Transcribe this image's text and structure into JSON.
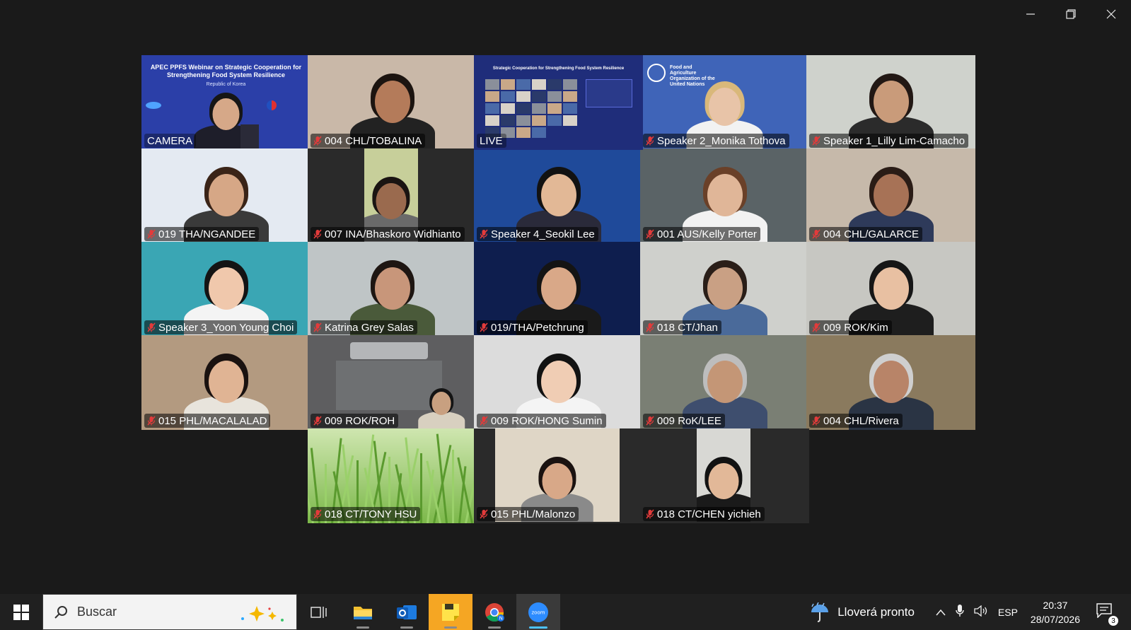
{
  "window": {
    "controls": [
      "minimize",
      "restore",
      "close"
    ]
  },
  "tiles": [
    {
      "label": "CAMERA",
      "muted": false,
      "kind": "slide-camera",
      "slide_title": "APEC PPFS Webinar on Strategic Cooperation for Strengthening Food System Resilience",
      "slide_subtitle": "Republic of Korea",
      "bg": "#2b3fa8"
    },
    {
      "label": "004 CHL/TOBALINA",
      "muted": true,
      "kind": "person",
      "bg": "#c9b8a8",
      "skin": "#b47b5a",
      "hair": "#1c1410",
      "shirt": "#222222"
    },
    {
      "label": "LIVE",
      "muted": false,
      "kind": "slide-live",
      "bg": "#1f2d7a",
      "slide_title": "Strategic Cooperation for Strengthening Food System Resilience"
    },
    {
      "label": "Speaker 2_Monika Tothova",
      "muted": true,
      "kind": "person-fao",
      "bg": "#3f64b8",
      "skin": "#e8c4a8",
      "hair": "#d9b87a",
      "shirt": "#f2f2f2",
      "org_text": "Food and Agriculture Organization of the United Nations"
    },
    {
      "label": "Speaker 1_Lilly Lim-Camacho",
      "muted": true,
      "kind": "person",
      "bg": "#cfd2cc",
      "skin": "#c99b7a",
      "hair": "#221814",
      "shirt": "#2b2b2b"
    },
    {
      "label": "019 THA/NGANDEE",
      "muted": true,
      "kind": "person",
      "bg": "#e4eaf2",
      "skin": "#d6a786",
      "hair": "#3a2418",
      "shirt": "#3a3a3a"
    },
    {
      "label": "007 INA/Bhaskoro Widhianto",
      "muted": true,
      "kind": "person-narrow",
      "bg": "#2a2a2a",
      "inner": "#c7cf9a",
      "skin": "#9a6a4e",
      "hair": "#1a1412",
      "shirt": "#6a6a6a"
    },
    {
      "label": "Speaker 4_Seokil Lee",
      "muted": true,
      "kind": "person",
      "bg": "#1f4a9a",
      "skin": "#e2b896",
      "hair": "#121212",
      "shirt": "#2a2a3a"
    },
    {
      "label": "001 AUS/Kelly Porter",
      "muted": true,
      "kind": "person",
      "bg": "#5a6366",
      "skin": "#e0b698",
      "hair": "#6a4028",
      "shirt": "#f2f2f2"
    },
    {
      "label": "004 CHL/GALARCE",
      "muted": true,
      "kind": "person",
      "bg": "#c6b9aa",
      "skin": "#a77256",
      "hair": "#2a1c16",
      "shirt": "#2e3a5a"
    },
    {
      "label": "Speaker 3_Yoon Young Choi",
      "muted": true,
      "kind": "person",
      "bg": "#3aa6b4",
      "skin": "#f0c8ac",
      "hair": "#141414",
      "shirt": "#f4f4f4"
    },
    {
      "label": "Katrina Grey Salas",
      "muted": true,
      "kind": "person",
      "bg": "#bfc5c6",
      "skin": "#c8967a",
      "hair": "#1e1612",
      "shirt": "#4a5a3a"
    },
    {
      "label": "019/THA/Petchrung",
      "muted": true,
      "kind": "person",
      "bg": "#0e1e4e",
      "skin": "#d9a888",
      "hair": "#141414",
      "shirt": "#1a1a1a"
    },
    {
      "label": "018 CT/Jhan",
      "muted": true,
      "kind": "person",
      "bg": "#cfd0cc",
      "skin": "#c9a084",
      "hair": "#2a1e18",
      "shirt": "#4a6a9a"
    },
    {
      "label": "009 ROK/Kim",
      "muted": true,
      "kind": "person",
      "bg": "#c7c7c2",
      "skin": "#e8c0a2",
      "hair": "#161616",
      "shirt": "#1e1e1e"
    },
    {
      "label": "015 PHL/MACALALAD",
      "muted": true,
      "kind": "person",
      "bg": "#b39a80",
      "skin": "#e0b494",
      "hair": "#1a1210",
      "shirt": "#e8e4dc"
    },
    {
      "label": "009 ROK/ROH",
      "muted": true,
      "kind": "room",
      "bg": "#5e5e60",
      "skin": "#c8a080",
      "hair": "#141414",
      "shirt": "#d8d0c0"
    },
    {
      "label": "009 ROK/HONG Sumin",
      "muted": true,
      "kind": "person",
      "bg": "#dcdcdc",
      "skin": "#f0cdb4",
      "hair": "#121212",
      "shirt": "#f4f4f4"
    },
    {
      "label": "009 RoK/LEE",
      "muted": true,
      "kind": "person",
      "bg": "#7a7f74",
      "skin": "#c49676",
      "hair": "#bdbdbd",
      "shirt": "#3e4e6e"
    },
    {
      "label": "004 CHL/Rivera",
      "muted": true,
      "kind": "person",
      "bg": "#8a7a5e",
      "skin": "#b88468",
      "hair": "#cfcfcf",
      "shirt": "#2a3444"
    },
    {
      "label": "018 CT/TONY HSU",
      "muted": true,
      "kind": "grass",
      "bg": "#8ac05a"
    },
    {
      "label": "015 PHL/Malonzo",
      "muted": true,
      "kind": "person-narrow",
      "bg": "#2a2a2a",
      "inner": "#dfd6c6",
      "skin": "#d8a888",
      "hair": "#1a1210",
      "shirt": "#8a8a8a"
    },
    {
      "label": "018 CT/CHEN yichieh",
      "muted": true,
      "kind": "person-narrow",
      "bg": "#2a2a2a",
      "inner": "#d8d8d4",
      "skin": "#e2b898",
      "hair": "#121212",
      "shirt": "#1a1a1a"
    }
  ],
  "taskbar": {
    "search_placeholder": "Buscar",
    "weather": "Lloverá pronto",
    "language": "ESP",
    "time": "20:37",
    "date": "28/07/2026",
    "notifications": "3",
    "apps": [
      "task-view",
      "file-explorer",
      "outlook",
      "sticky-notes",
      "chrome",
      "zoom"
    ],
    "active_app": "zoom"
  },
  "colors": {
    "window_bg": "#1a1a1a",
    "live_border": "#3ecf8e",
    "taskbar_bg": "#202020",
    "accent": "#4cc2ff"
  }
}
